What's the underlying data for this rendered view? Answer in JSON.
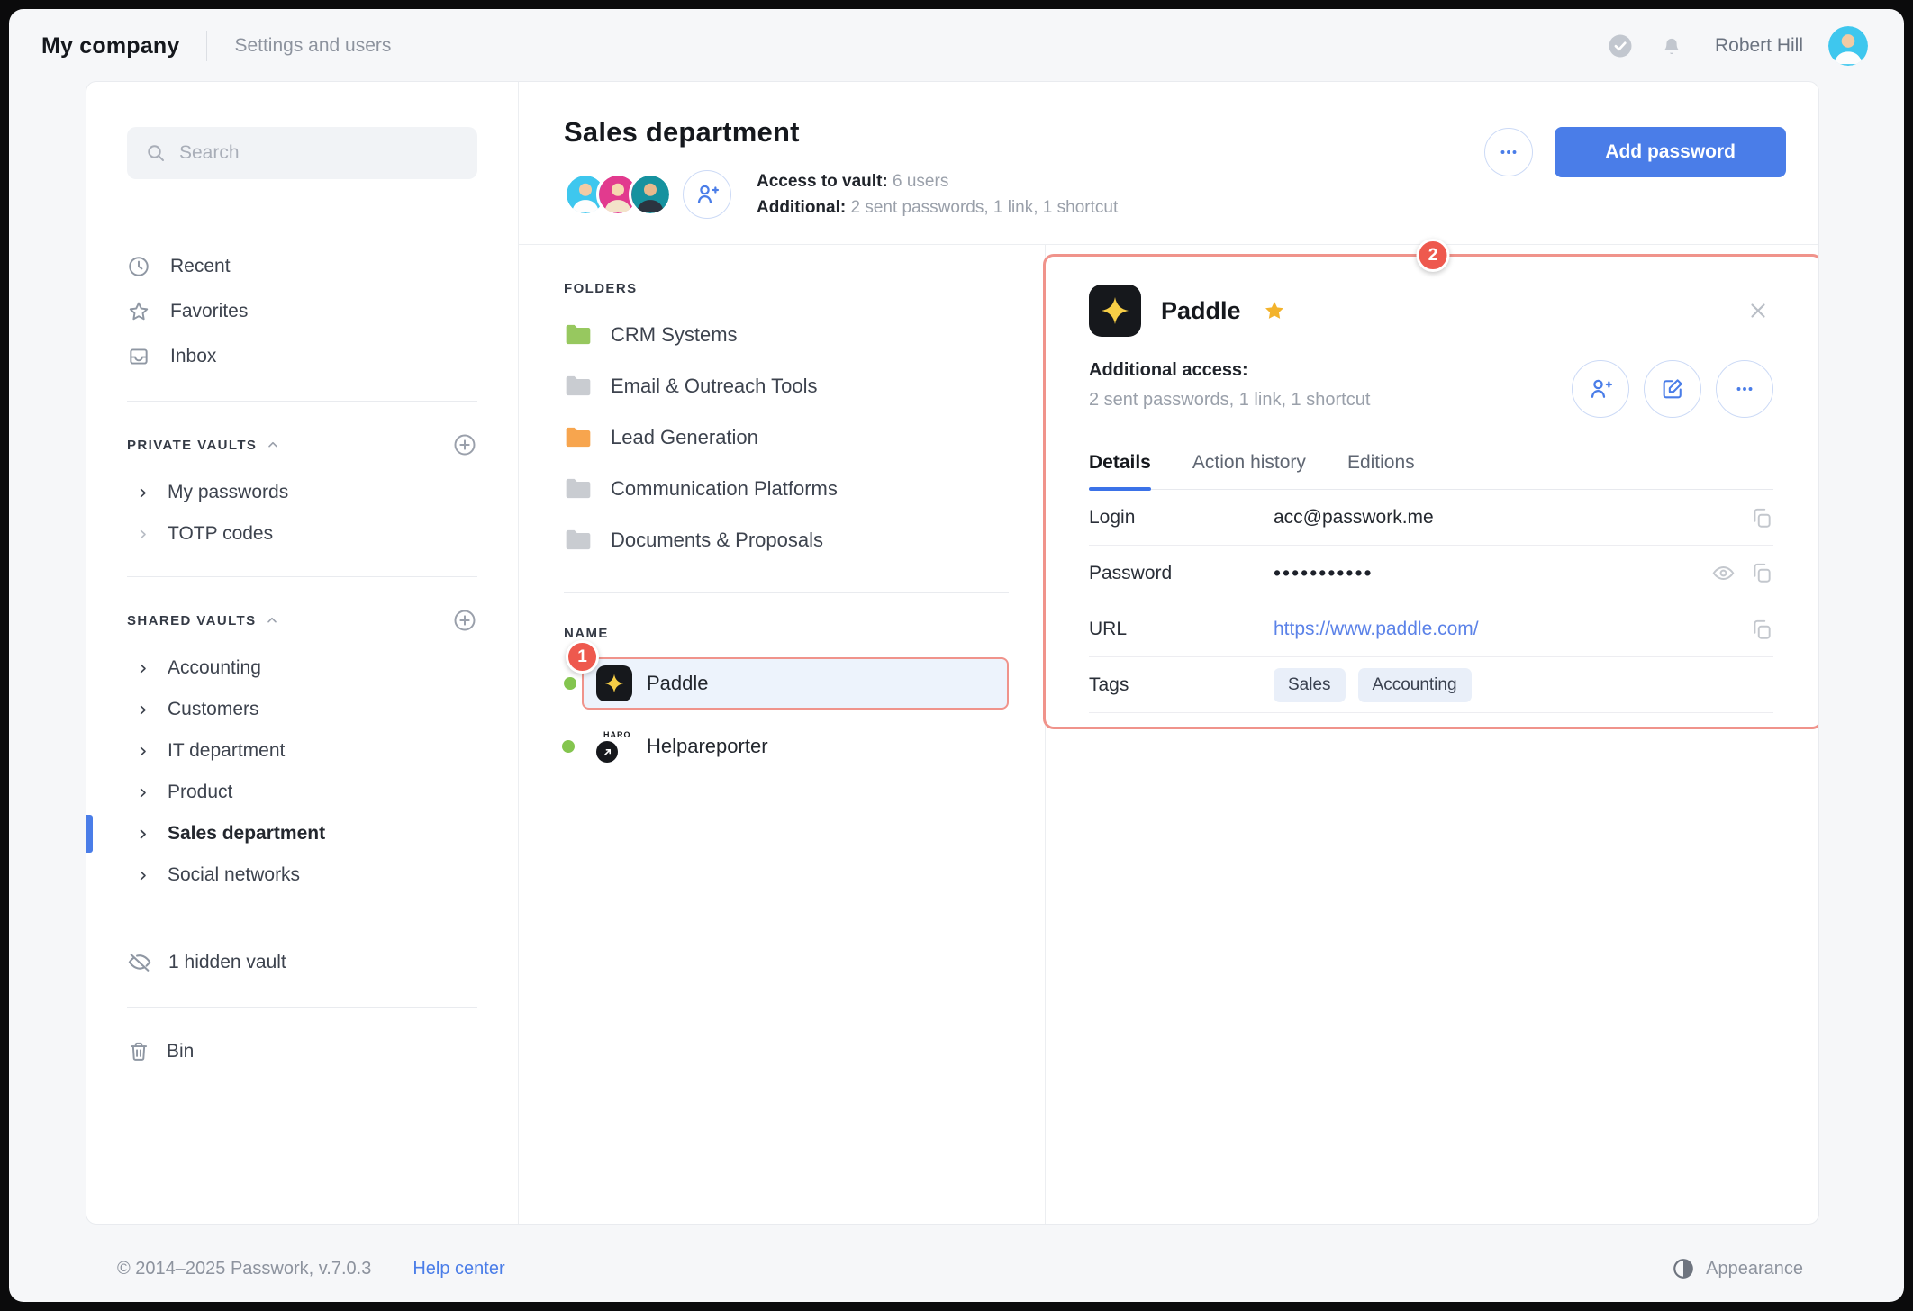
{
  "topbar": {
    "company": "My company",
    "section": "Settings and users",
    "user": "Robert Hill"
  },
  "sidebar": {
    "search_placeholder": "Search",
    "nav": {
      "recent": "Recent",
      "favorites": "Favorites",
      "inbox": "Inbox"
    },
    "private_vaults": {
      "label": "PRIVATE VAULTS",
      "items": [
        "My passwords",
        "TOTP codes"
      ]
    },
    "shared_vaults": {
      "label": "SHARED VAULTS",
      "items": [
        "Accounting",
        "Customers",
        "IT department",
        "Product",
        "Sales department",
        "Social networks"
      ],
      "active_item": "Sales department"
    },
    "hidden_vault": "1 hidden vault",
    "bin": "Bin"
  },
  "header": {
    "title": "Sales department",
    "access_label": "Access to vault:",
    "access_value": "6 users",
    "additional_label": "Additional:",
    "additional_value": "2 sent passwords, 1 link, 1 shortcut",
    "add_password_label": "Add password"
  },
  "folders": {
    "label": "FOLDERS",
    "items": [
      {
        "name": "CRM Systems",
        "color": "#97c85f"
      },
      {
        "name": "Email & Outreach Tools",
        "color": "#c9ccd1"
      },
      {
        "name": "Lead Generation",
        "color": "#f7a54e"
      },
      {
        "name": "Communication Platforms",
        "color": "#c9ccd1"
      },
      {
        "name": "Documents & Proposals",
        "color": "#c9ccd1"
      }
    ]
  },
  "records": {
    "label": "NAME",
    "rows": [
      {
        "name": "Paddle",
        "selected": true
      },
      {
        "name": "Helpareporter",
        "selected": false
      }
    ]
  },
  "detail": {
    "title": "Paddle",
    "additional_access_label": "Additional access:",
    "additional_access_value": "2 sent passwords, 1 link, 1 shortcut",
    "tabs": [
      "Details",
      "Action history",
      "Editions"
    ],
    "active_tab": "Details",
    "fields": {
      "login_label": "Login",
      "login_value": "acc@passwork.me",
      "password_label": "Password",
      "password_value": "•••••••••••",
      "url_label": "URL",
      "url_value": "https://www.paddle.com/",
      "tags_label": "Tags",
      "tags": [
        "Sales",
        "Accounting"
      ]
    }
  },
  "annotations": {
    "step1": "1",
    "step2": "2"
  },
  "footer": {
    "copyright": "© 2014–2025 Passwork, v.7.0.3",
    "help": "Help center",
    "appearance": "Appearance"
  },
  "colors": {
    "accent_blue": "#4a7de8",
    "link_blue": "#5b82e8",
    "annotation_red": "#ee594e",
    "annotation_border": "#f0938b",
    "selected_row_bg": "#edf3fc",
    "green_dot": "#84c54f",
    "folder_green": "#97c85f",
    "folder_orange": "#f7a54e",
    "folder_gray": "#c9ccd1",
    "tag_bg": "#e9eff9",
    "paddle_star_yellow": "#f7ce46"
  }
}
